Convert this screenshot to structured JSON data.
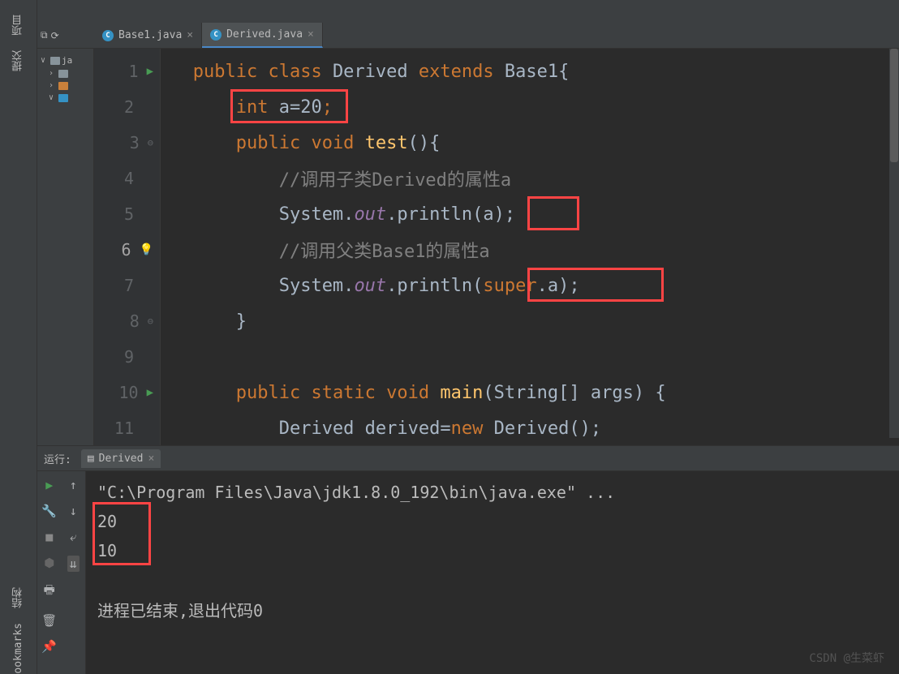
{
  "sidebar": {
    "labels": [
      "项目",
      "提交",
      "结构",
      "ookmarks"
    ]
  },
  "tabs": [
    {
      "label": "Base1.java",
      "active": false
    },
    {
      "label": "Derived.java",
      "active": true
    }
  ],
  "projectRoot": "ja",
  "code": {
    "lines": [
      {
        "n": "1",
        "segs": [
          {
            "c": "kw",
            "t": "public class "
          },
          {
            "c": "txt",
            "t": "Derived "
          },
          {
            "c": "kw",
            "t": "extends "
          },
          {
            "c": "txt",
            "t": "Base1{"
          }
        ]
      },
      {
        "n": "2",
        "segs": [
          {
            "c": "txt",
            "t": "    "
          },
          {
            "c": "kw",
            "t": "int "
          },
          {
            "c": "txt",
            "t": "a="
          },
          {
            "c": "txt",
            "t": "20"
          },
          {
            "c": "kw",
            "t": ";"
          }
        ]
      },
      {
        "n": "3",
        "segs": [
          {
            "c": "txt",
            "t": "    "
          },
          {
            "c": "kw",
            "t": "public void "
          },
          {
            "c": "mth",
            "t": "test"
          },
          {
            "c": "txt",
            "t": "(){"
          }
        ]
      },
      {
        "n": "4",
        "segs": [
          {
            "c": "txt",
            "t": "        "
          },
          {
            "c": "cmt",
            "t": "//调用子类Derived的属性a"
          }
        ]
      },
      {
        "n": "5",
        "segs": [
          {
            "c": "txt",
            "t": "        System."
          },
          {
            "c": "fld",
            "t": "out"
          },
          {
            "c": "txt",
            "t": ".println(a);"
          }
        ]
      },
      {
        "n": "6",
        "segs": [
          {
            "c": "txt",
            "t": "        "
          },
          {
            "c": "cmt",
            "t": "//调用父类Base1的属性a"
          }
        ]
      },
      {
        "n": "7",
        "segs": [
          {
            "c": "txt",
            "t": "        System."
          },
          {
            "c": "fld",
            "t": "out"
          },
          {
            "c": "txt",
            "t": ".println("
          },
          {
            "c": "kw",
            "t": "super"
          },
          {
            "c": "txt",
            "t": ".a);"
          }
        ]
      },
      {
        "n": "8",
        "segs": [
          {
            "c": "txt",
            "t": "    }"
          }
        ]
      },
      {
        "n": "9",
        "segs": [
          {
            "c": "txt",
            "t": ""
          }
        ]
      },
      {
        "n": "10",
        "segs": [
          {
            "c": "txt",
            "t": "    "
          },
          {
            "c": "kw",
            "t": "public static void "
          },
          {
            "c": "mth",
            "t": "main"
          },
          {
            "c": "txt",
            "t": "(String[] args) {"
          }
        ]
      },
      {
        "n": "11",
        "segs": [
          {
            "c": "txt",
            "t": "        Derived derived="
          },
          {
            "c": "kw",
            "t": "new "
          },
          {
            "c": "txt",
            "t": "Derived();"
          }
        ]
      }
    ]
  },
  "gutter": {
    "markers": {
      "1": "run",
      "3": "fold-open",
      "6": "bulb",
      "8": "fold-close",
      "10": "run-fold"
    },
    "current": "6"
  },
  "runPanel": {
    "label": "运行:",
    "tab": "Derived",
    "cmd": "\"C:\\Program Files\\Java\\jdk1.8.0_192\\bin\\java.exe\" ...",
    "out1": "20",
    "out2": "10",
    "exit": "进程已结束,退出代码0"
  },
  "watermark": "CSDN @生菜虾"
}
